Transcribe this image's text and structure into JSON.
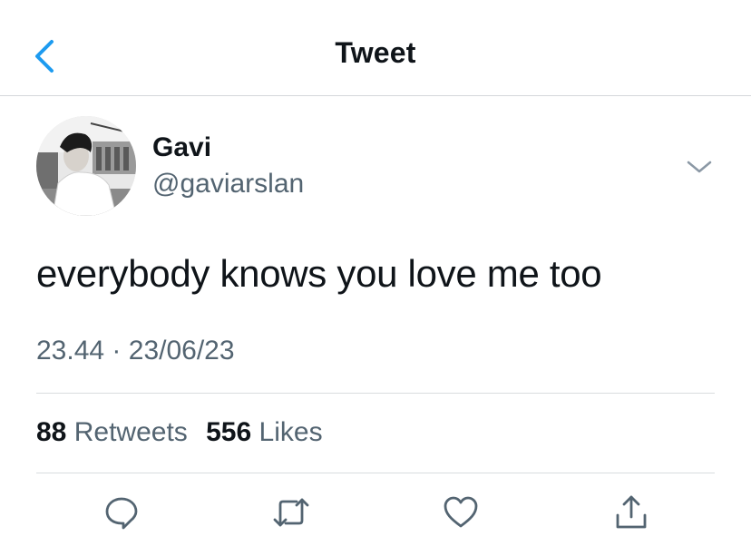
{
  "header": {
    "title": "Tweet",
    "back_icon": "chevron-left-icon"
  },
  "author": {
    "name": "Gavi",
    "handle": "@gaviarslan"
  },
  "tweet": {
    "text": "everybody knows you love me too",
    "time": "23.44",
    "separator": "·",
    "date": "23/06/23"
  },
  "stats": {
    "retweets_count": "88",
    "retweets_label": "Retweets",
    "likes_count": "556",
    "likes_label": "Likes"
  },
  "actions": [
    "reply-icon",
    "retweet-icon",
    "like-icon",
    "share-icon"
  ],
  "colors": {
    "accent": "#1d9bf0",
    "text": "#0f1419",
    "muted": "#536471",
    "divider": "#d9dcdf"
  }
}
